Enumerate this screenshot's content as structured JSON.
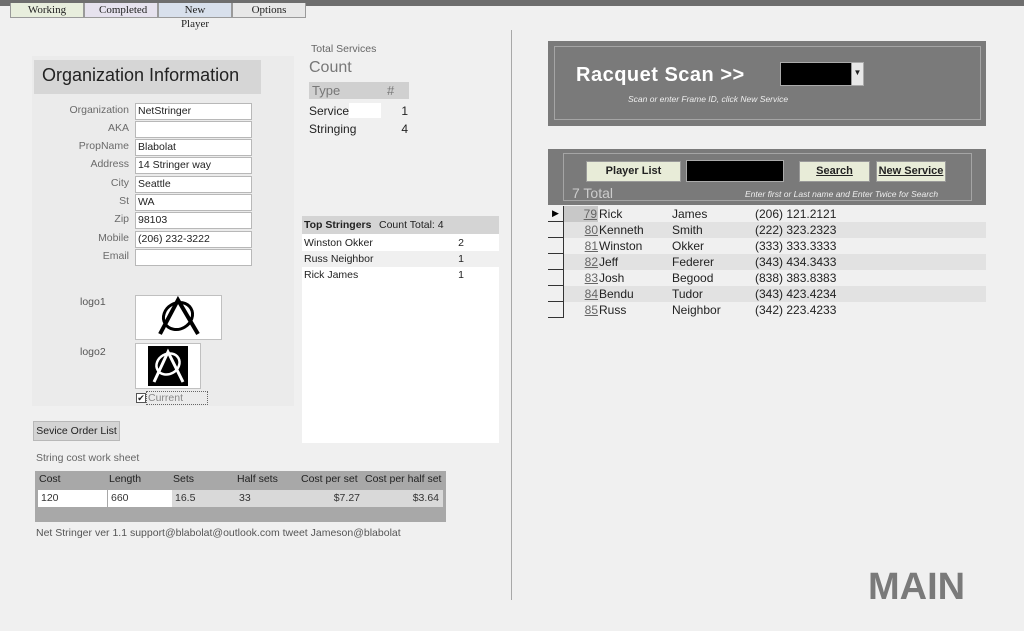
{
  "tabs": [
    "Working",
    "Completed",
    "New Player",
    "Options"
  ],
  "org": {
    "title": "Organization Information",
    "fields": [
      {
        "label": "Organization",
        "value": "NetStringer"
      },
      {
        "label": "AKA",
        "value": ""
      },
      {
        "label": "PropName",
        "value": "Blabolat"
      },
      {
        "label": "Address",
        "value": "14 Stringer way"
      },
      {
        "label": "City",
        "value": "Seattle"
      },
      {
        "label": "St",
        "value": "WA"
      },
      {
        "label": "Zip",
        "value": "98103"
      },
      {
        "label": "Mobile",
        "value": "(206) 232-3222"
      },
      {
        "label": "Email",
        "value": ""
      }
    ],
    "logo1_label": "logo1",
    "logo2_label": "logo2",
    "current_label": "Current",
    "current_checked": "✔"
  },
  "service_order_button": "Sevice Order List",
  "worksheet": {
    "title": "String cost work sheet",
    "headers": [
      "Cost",
      "Length",
      "Sets",
      "Half sets",
      "Cost per set",
      "Cost per half set"
    ],
    "values": [
      "120",
      "660",
      "16.5",
      "33",
      "$7.27",
      "$3.64"
    ]
  },
  "footer": "Net Stringer ver 1.1  support@blabolat@outlook.com  tweet  Jameson@blabolat",
  "services": {
    "total_label": "Total Services",
    "count_label": "Count",
    "col_type": "Type",
    "col_num": "#",
    "rows": [
      {
        "type": "Service",
        "count": "1"
      },
      {
        "type": "Stringing",
        "count": "4"
      }
    ]
  },
  "stringers": {
    "title": "Top Stringers",
    "count_total": "Count Total: 4",
    "rows": [
      {
        "name": "Winston Okker",
        "count": "2"
      },
      {
        "name": "Russ Neighbor",
        "count": "1"
      },
      {
        "name": "Rick James",
        "count": "1"
      }
    ]
  },
  "racquet_scan": {
    "title": "Racquet Scan  >>",
    "dropdown_icon": "chevron-down-icon",
    "hint": "Scan or enter Frame ID, click New Service"
  },
  "players": {
    "player_list_button": "Player List",
    "search_button": "Search",
    "new_service_button": "New Service",
    "total": "7 Total",
    "hint": "Enter first or Last name and Enter Twice for Search",
    "rows": [
      {
        "id": "79",
        "first": "Rick",
        "last": "James",
        "phone": "(206) 121.2121"
      },
      {
        "id": "80",
        "first": "Kenneth",
        "last": "Smith",
        "phone": "(222) 323.2323"
      },
      {
        "id": "81",
        "first": "Winston",
        "last": "Okker",
        "phone": "(333) 333.3333"
      },
      {
        "id": "82",
        "first": "Jeff",
        "last": "Federer",
        "phone": "(343) 434.3433"
      },
      {
        "id": "83",
        "first": "Josh",
        "last": "Begood",
        "phone": "(838) 383.8383"
      },
      {
        "id": "84",
        "first": "Bendu",
        "last": "Tudor",
        "phone": "(343) 423.4234"
      },
      {
        "id": "85",
        "first": "Russ",
        "last": "Neighbor",
        "phone": "(342) 223.4233"
      }
    ]
  },
  "main_label": "MAIN"
}
